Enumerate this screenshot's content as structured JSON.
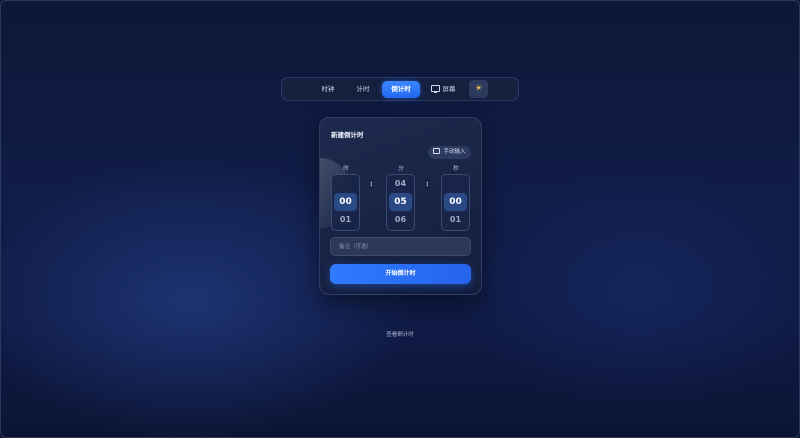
{
  "nav": {
    "tabs": [
      {
        "label": "时钟"
      },
      {
        "label": "计时"
      },
      {
        "label": "倒计时"
      },
      {
        "label": "屏幕"
      }
    ],
    "active_tab": "倒计时",
    "theme_icon": "sun-icon"
  },
  "card": {
    "title": "新建倒计时",
    "manual_input_label": "手动输入",
    "columns": [
      {
        "label": "时",
        "prev": "",
        "selected": "00",
        "next": "01"
      },
      {
        "label": "分",
        "prev": "04",
        "selected": "05",
        "next": "06"
      },
      {
        "label": "秒",
        "prev": "",
        "selected": "00",
        "next": "01"
      }
    ],
    "separator": ":",
    "note_placeholder": "备注（可选）",
    "start_button": "开始倒计时"
  },
  "footer": {
    "view_link": "查看倒计时"
  },
  "colors": {
    "accent": "#2f7bff",
    "background": "#101d48",
    "card": "#1e2a4e"
  }
}
